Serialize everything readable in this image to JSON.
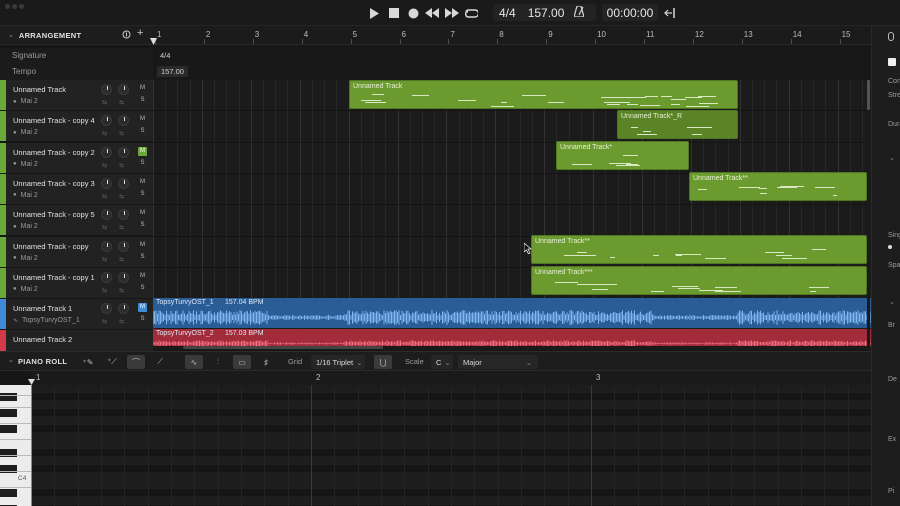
{
  "transport": {
    "time_signature": "4/4",
    "tempo": "157.00",
    "position": "00:00:00"
  },
  "arrangement": {
    "title": "ARRANGEMENT",
    "ruler": [
      "1",
      "2",
      "3",
      "4",
      "5",
      "6",
      "7",
      "8",
      "9",
      "10",
      "11",
      "12",
      "13",
      "14",
      "15"
    ],
    "signature_label": "Signature",
    "signature_value": "4/4",
    "tempo_label": "Tempo",
    "tempo_value": "157.00",
    "tracks": [
      {
        "name": "Unnamed Track",
        "input": "Mai 2",
        "color": "#6aa938",
        "mute": "M",
        "solo": "S"
      },
      {
        "name": "Unnamed Track - copy 4",
        "input": "Mai 2",
        "color": "#6aa938",
        "mute": "M",
        "solo": "S"
      },
      {
        "name": "Unnamed Track - copy 2",
        "input": "Mai 2",
        "color": "#6aa938",
        "mute": "M",
        "solo": "S"
      },
      {
        "name": "Unnamed Track - copy 3",
        "input": "Mai 2",
        "color": "#6aa938",
        "mute": "M",
        "solo": "S"
      },
      {
        "name": "Unnamed Track - copy 5",
        "input": "Mai 2",
        "color": "#6aa938",
        "mute": "M",
        "solo": "S"
      },
      {
        "name": "Unnamed Track - copy",
        "input": "Mai 2",
        "color": "#6aa938",
        "mute": "M",
        "solo": "S"
      },
      {
        "name": "Unnamed Track - copy 1",
        "input": "Mai 2",
        "color": "#6aa938",
        "mute": "M",
        "solo": "S"
      },
      {
        "name": "Unnamed Track 1",
        "input": "TopsyTurvyOST_1",
        "color": "#3f8ad9",
        "mute": "M",
        "solo": "S"
      },
      {
        "name": "Unnamed Track 2",
        "input": "",
        "color": "#d23a4a",
        "mute": "",
        "solo": ""
      }
    ],
    "clips": [
      {
        "title": "Unnamed Track"
      },
      {
        "title": "Unnamed Track*_R"
      },
      {
        "title": "Unnamed Track*"
      },
      {
        "title": "Unnamed Track**"
      },
      {
        "title": "Unnamed Track**"
      },
      {
        "title": "Unnamed Track***"
      }
    ],
    "audio_clips": [
      {
        "title": "TopsyTurvyOST_1",
        "bpm": "157.04 BPM"
      },
      {
        "title": "TopsyTurvyOST_2",
        "bpm": "157.03 BPM"
      }
    ]
  },
  "piano_roll": {
    "title": "PIANO ROLL",
    "grid_label": "Grid",
    "grid_value": "1/16 Triplet",
    "scale_label": "Scale",
    "scale_root": "C",
    "scale_mode": "Major",
    "ruler": [
      "1",
      "2",
      "3"
    ],
    "key_label": "C4"
  },
  "inspector": {
    "labels": [
      "Con",
      "Stre",
      "Dura",
      "Sing",
      "Spa",
      "Br",
      "De",
      "Ex",
      "Pi"
    ]
  },
  "colors": {
    "midi_clip": "#6b9a2e",
    "audio_blue": "#3f8ad9",
    "audio_red": "#d23a4a"
  }
}
